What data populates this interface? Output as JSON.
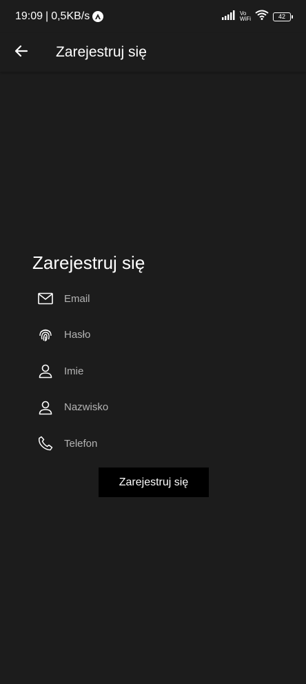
{
  "status_bar": {
    "time": "19:09",
    "separator": "|",
    "network_speed": "0,5KB/s",
    "vowifi_top": "Vo",
    "vowifi_bottom": "WiFi",
    "battery_level": "42",
    "icons": [
      "app-notification-icon",
      "signal-icon",
      "vowifi-icon",
      "wifi-icon",
      "battery-icon"
    ]
  },
  "app_bar": {
    "back_icon": "arrow-left-icon",
    "title": "Zarejestruj się"
  },
  "form": {
    "title": "Zarejestruj się",
    "fields": [
      {
        "icon": "mail-icon",
        "placeholder": "Email"
      },
      {
        "icon": "fingerprint-icon",
        "placeholder": "Hasło"
      },
      {
        "icon": "person-icon",
        "placeholder": "Imie"
      },
      {
        "icon": "person-icon",
        "placeholder": "Nazwisko"
      },
      {
        "icon": "phone-icon",
        "placeholder": "Telefon"
      }
    ],
    "submit_label": "Zarejestruj się"
  },
  "colors": {
    "background": "#1c1c1c",
    "text": "#ffffff",
    "placeholder": "#b4b4b4",
    "button": "#000000"
  }
}
